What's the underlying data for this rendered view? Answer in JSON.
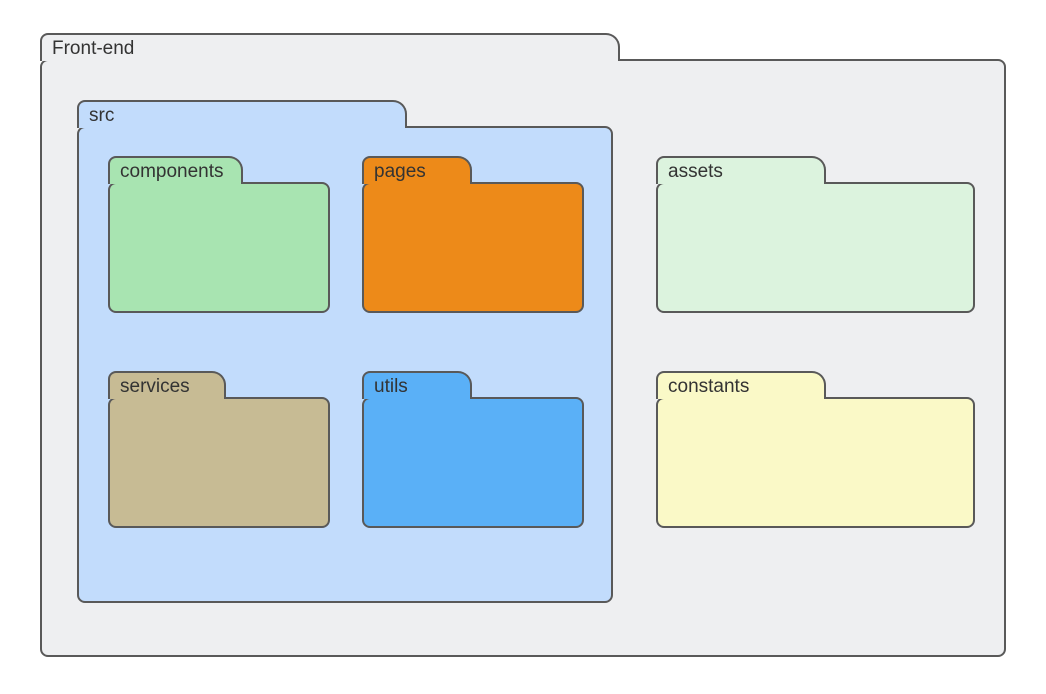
{
  "diagram": {
    "root": {
      "label": "Front-end",
      "fill": "#eeeff1",
      "border": "#595959",
      "textColor": "#333333"
    },
    "src": {
      "label": "src",
      "fill": "#c2dcfc",
      "border": "#595959",
      "textColor": "#333333"
    },
    "components": {
      "label": "components",
      "fill": "#a8e4b1",
      "border": "#595959",
      "textColor": "#333333"
    },
    "pages": {
      "label": "pages",
      "fill": "#ed8a19",
      "border": "#595959",
      "textColor": "#333333"
    },
    "services": {
      "label": "services",
      "fill": "#c7bb94",
      "border": "#595959",
      "textColor": "#333333"
    },
    "utils": {
      "label": "utils",
      "fill": "#5ab0f7",
      "border": "#595959",
      "textColor": "#333333"
    },
    "assets": {
      "label": "assets",
      "fill": "#dcf3de",
      "border": "#595959",
      "textColor": "#333333"
    },
    "constants": {
      "label": "constants",
      "fill": "#faf9c7",
      "border": "#595959",
      "textColor": "#333333"
    }
  }
}
